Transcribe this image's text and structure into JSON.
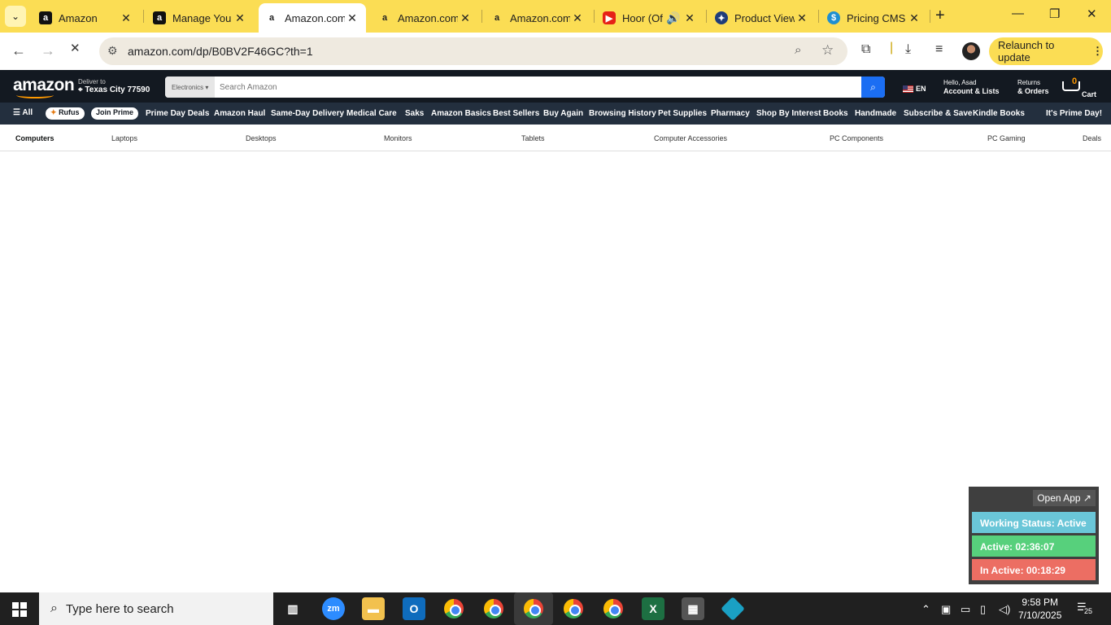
{
  "browser": {
    "tabs": [
      {
        "title": "Amazon",
        "favicon": "amazon-icon",
        "active": false
      },
      {
        "title": "Manage You",
        "favicon": "amazon-icon",
        "active": false
      },
      {
        "title": "Amazon.com",
        "favicon": "amazon-icon",
        "active": true
      },
      {
        "title": "Amazon.com",
        "favicon": "amazon-icon",
        "active": false
      },
      {
        "title": "Amazon.com",
        "favicon": "amazon-icon",
        "active": false
      },
      {
        "title": "Hoor (Of",
        "favicon": "youtube-icon",
        "active": false
      },
      {
        "title": "Product View",
        "favicon": "product-view-icon",
        "active": false
      },
      {
        "title": "Pricing CMS",
        "favicon": "pricing-cms-icon",
        "active": false
      }
    ],
    "url": "amazon.com/dp/B0BV2F46GC?th=1",
    "relaunch_label": "Relaunch to update",
    "accent_color": "#fbdd54"
  },
  "amazon": {
    "logo": "amazon",
    "deliver_to": "Deliver to",
    "location": "Texas City 77590",
    "search_category": "Electronics",
    "search_placeholder": "Search Amazon",
    "lang": "EN",
    "account_greeting": "Hello, Asad",
    "account_label": "Account & Lists",
    "returns_label": "Returns",
    "orders_label": "& Orders",
    "cart_count": "0",
    "cart_label": "Cart",
    "subnav": {
      "all": "All",
      "rufus": "Rufus",
      "join_prime": "Join Prime",
      "items": [
        "Prime Day Deals",
        "Amazon Haul",
        "Same-Day Delivery",
        "Medical Care",
        "Saks",
        "Amazon Basics",
        "Best Sellers",
        "Buy Again",
        "Browsing History",
        "Pet Supplies",
        "Pharmacy",
        "Shop By Interest",
        "Books",
        "Handmade",
        "Subscribe & Save",
        "Kindle Books"
      ],
      "promo": "It's Prime Day!"
    },
    "categories": [
      "Computers",
      "Laptops",
      "Desktops",
      "Monitors",
      "Tablets",
      "Computer Accessories",
      "PC Components",
      "PC Gaming",
      "Deals"
    ]
  },
  "widget": {
    "open_app": "Open App ↗",
    "working_status": "Working Status: Active",
    "active": "Active: 02:36:07",
    "inactive": "In Active: 00:18:29"
  },
  "taskbar": {
    "search_placeholder": "Type here to search",
    "time": "9:58 PM",
    "date": "7/10/2025",
    "notification_count": "25"
  }
}
